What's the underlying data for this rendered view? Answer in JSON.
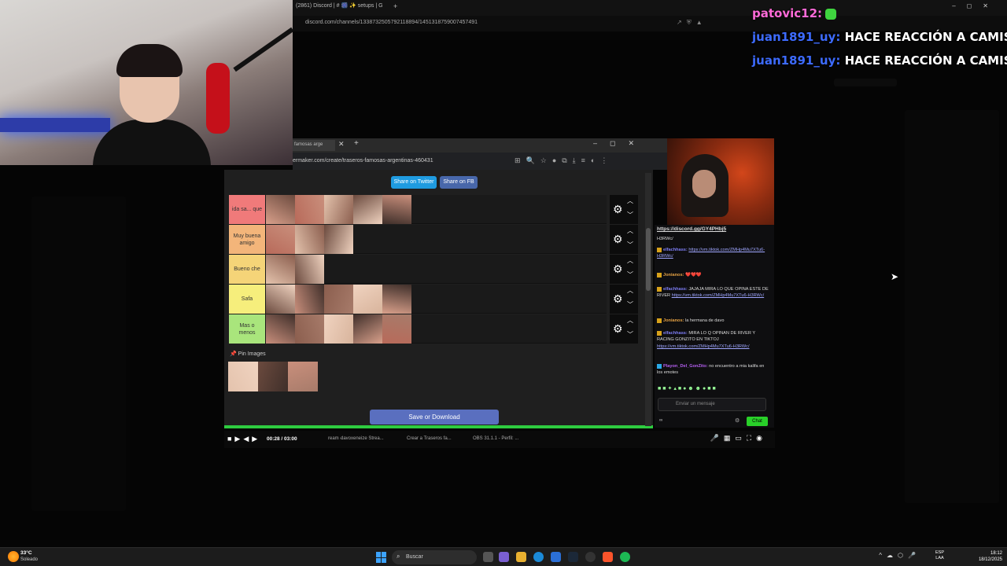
{
  "outer_browser": {
    "tab_title": "(2861) Discord | # 🎆 ✨ setups | G",
    "new_tab": "+",
    "url": "discord.com/channels/1338732505792118894/1451318759007457491"
  },
  "chat_overlay": [
    {
      "user": "patovic12:",
      "message": ""
    },
    {
      "user": "juan1891_uy:",
      "message": "HACE REACCIÓN A CAMISE"
    },
    {
      "user": "juan1891_uy:",
      "message": "HACE REACCIÓN A CAMISE"
    }
  ],
  "inner_browser": {
    "tab_title": "famosas arge",
    "url": "ermaker.com/create/traseros-famosas-argentinas-460431"
  },
  "tierlist": {
    "share_twitter": "Share on Twitter",
    "share_fb": "Share on FB",
    "tiers": [
      {
        "label": "ida sa... que",
        "color": "#f07a7a",
        "image_count": 5
      },
      {
        "label": "Muy buena amigo",
        "color": "#f3b57a",
        "image_count": 3
      },
      {
        "label": "Bueno che",
        "color": "#f5d478",
        "image_count": 2
      },
      {
        "label": "Safa",
        "color": "#f6ee7c",
        "image_count": 5
      },
      {
        "label": "Mas o menos",
        "color": "#a9e57c",
        "image_count": 5
      }
    ],
    "pin_label": "📌 Pin Images",
    "pin_count": 3,
    "save_button": "Save or Download",
    "progress": 1.0
  },
  "twitch_chat": {
    "link": "https://discord.gg/GY4PHbj5",
    "messages": [
      {
        "user": "",
        "text": "H3RWc/",
        "link": ""
      },
      {
        "user": "elfachhass:",
        "text": "",
        "link": "https://vm.tiktok.com/ZMHp4Mu7XTu6-H3RWc/"
      },
      {
        "user": "Jonianos:",
        "text": "❤️❤️❤️",
        "link": ""
      },
      {
        "user": "elfachhass:",
        "text": "JAJAJA MIRA LO QUE OPINA ESTE DE RIVER",
        "link": "https://vm.tiktok.com/ZMHp4Mu7XTu6-H3RWc/"
      },
      {
        "user": "Jonianos:",
        "text": "la hermana de davo",
        "link": ""
      },
      {
        "user": "elfachhass:",
        "text": "MIRA LO Q OPINAN DE RIVER Y RACING GONZITO EN TIKTOJ",
        "link": "https://vm.tiktok.com/ZMHp4Mu7XTu6-H3RWc/"
      },
      {
        "user": "Playon_Del_GonZito:",
        "text": "no encuentro a mia kalifa en los emotes",
        "link": ""
      }
    ],
    "input_placeholder": "Enviar un mensaje",
    "chat_button": "Chat",
    "points": "∞"
  },
  "video_bar": {
    "time": "00:28 / 03:00",
    "item1": "ream -",
    "item2": "davoxeneize Strea...",
    "item3": "Crear a Traseros fa...",
    "item4": "OBS 31.1.1 - Perfil: ..."
  },
  "taskbar": {
    "temp": "33°C",
    "weather": "Soleado",
    "search": "Buscar",
    "lang_top": "ESP",
    "lang_bottom": "LAA",
    "time": "18:12",
    "date": "18/12/2025"
  }
}
